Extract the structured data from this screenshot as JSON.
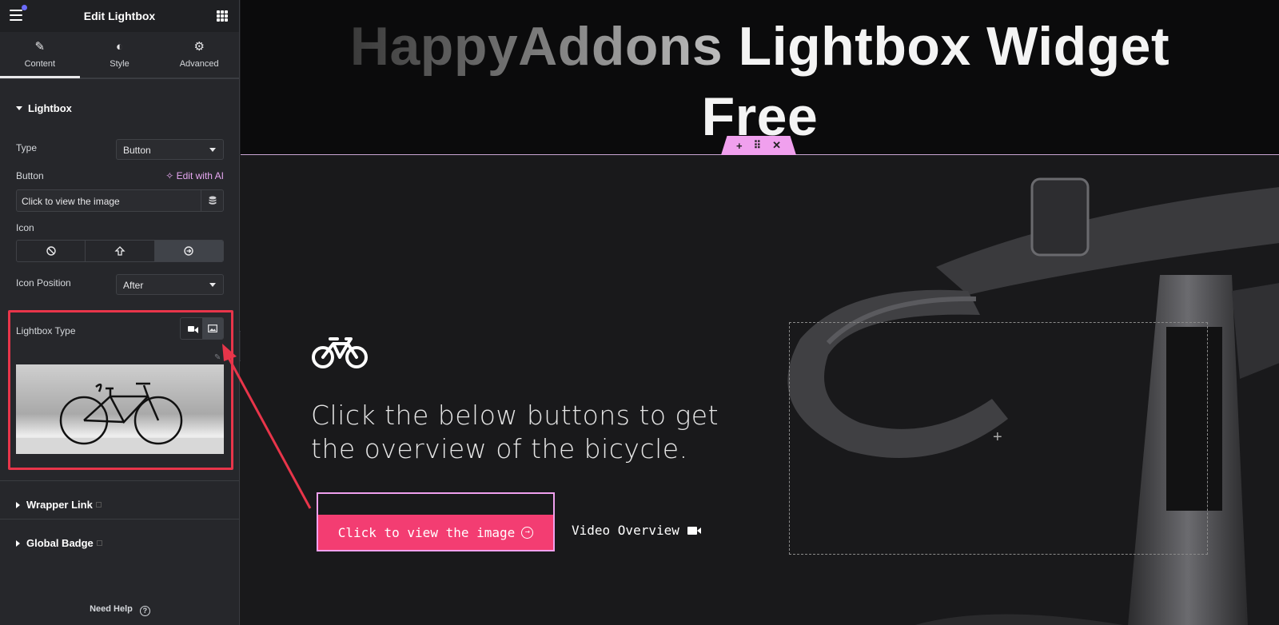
{
  "sidebar": {
    "title": "Edit Lightbox",
    "tabs": [
      {
        "label": "Content",
        "icon": "pencil-icon"
      },
      {
        "label": "Style",
        "icon": "half-circle-icon"
      },
      {
        "label": "Advanced",
        "icon": "gear-icon"
      }
    ],
    "lightbox_section": "Lightbox",
    "type_label": "Type",
    "type_value": "Button",
    "button_label": "Button",
    "edit_ai": "Edit with AI",
    "button_text_value": "Click to view the image",
    "icon_label": "Icon",
    "icon_options": [
      "none-icon",
      "upload-icon",
      "arrow-circle-icon"
    ],
    "icon_position_label": "Icon Position",
    "icon_position_value": "After",
    "lightbox_type_label": "Lightbox Type",
    "lightbox_type_options": [
      "video-icon",
      "image-icon"
    ],
    "wrapper_link": "Wrapper Link",
    "global_badge": "Global Badge",
    "need_help": "Need Help"
  },
  "canvas": {
    "heading_dim": "HappyAddons",
    "heading_bright_1": "Lightbox Widget",
    "heading_bright_2": "Free",
    "lead_text": "Click the below buttons to get the overview of the bicycle.",
    "cta_label": "Click to view the image",
    "video_label": "Video Overview"
  },
  "colors": {
    "accent_pink": "#f33d72",
    "handle_pink": "#f0a0ee",
    "highlight_red": "#e8354a",
    "ai_purple": "#e7a7f2"
  }
}
